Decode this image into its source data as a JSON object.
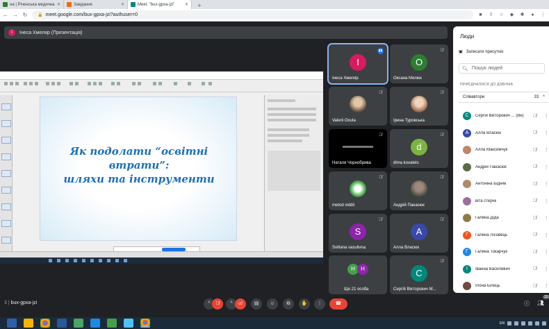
{
  "browser": {
    "tabs": [
      {
        "label": "на | Річенська медична",
        "color": "#2e7d32",
        "active": false
      },
      {
        "label": "Завдання",
        "color": "#ef6c00",
        "active": false
      },
      {
        "label": "Meet: \"bux-gpxa-jzi\"",
        "color": "#00897b",
        "active": true
      }
    ],
    "url": "meet.google.com/bux-gpxa-jzi?authuser=0"
  },
  "meet": {
    "presenter_initial": "I",
    "presenter_label": "Інеса Хмеляр (Презентація)",
    "meeting_code": "bux-gpxa-jzi",
    "badge": "33",
    "shared_slide": {
      "title_line1": "Як подолати “освітні втрати”:",
      "title_line2": "шляхи та інструменти"
    },
    "tiles": [
      {
        "initial": "І",
        "name": "Інеса Хмеляр",
        "color": "#d81b60",
        "speaking": true
      },
      {
        "initial": "О",
        "name": "Оксана Мелюк",
        "color": "#2e7d32"
      },
      {
        "initial": "",
        "name": "Valerii Oxuta",
        "color": "#8d6e63"
      },
      {
        "initial": "",
        "name": "Ірина Туровська",
        "color": "#bc8f6f"
      },
      {
        "initial": "",
        "name": "Наталя Чорнобрива",
        "color": "#000000"
      },
      {
        "initial": "d",
        "name": "dima kovalets",
        "color": "#7cb342"
      },
      {
        "initial": "",
        "name": "metod viddil",
        "color": "#4caf50"
      },
      {
        "initial": "",
        "name": "Андрій Панасюк",
        "color": "#5d6b4a"
      },
      {
        "initial": "S",
        "name": "Svitlana vasulivna",
        "color": "#8e24aa"
      },
      {
        "initial": "А",
        "name": "Алла Власюк",
        "color": "#3949ab"
      },
      {
        "initial": "",
        "name": "Ще 21 особа",
        "color": "#43a047"
      },
      {
        "initial": "С",
        "name": "Сергій Вікторович М...",
        "color": "#00897b"
      }
    ],
    "more_initials": [
      "Н",
      "Н"
    ]
  },
  "people": {
    "title": "Люди",
    "record_label": "Записати присутніх",
    "search_placeholder": "Пошук людей",
    "section_label": "ПРИЄДНАЛИСЯ ДО ДЗВІНКА",
    "group_label": "Співавтори",
    "group_count": "33",
    "list": [
      {
        "initial": "С",
        "name": "Сергій Вікторович ... (Ви)",
        "color": "#00897b"
      },
      {
        "initial": "А",
        "name": "Алла Власюк",
        "color": "#3949ab"
      },
      {
        "initial": "",
        "name": "Алла Максимчук",
        "color": "#c0846a"
      },
      {
        "initial": "",
        "name": "Андрій Панасюк",
        "color": "#5d6b4a"
      },
      {
        "initial": "",
        "name": "Антоніна Бідняк",
        "color": "#b08968"
      },
      {
        "initial": "",
        "name": "віта стерчк",
        "color": "#9c6f9c"
      },
      {
        "initial": "",
        "name": "Галина Діда",
        "color": "#8d7b4a"
      },
      {
        "initial": "Г",
        "name": "Галина Лісовець",
        "color": "#f4511e"
      },
      {
        "initial": "Г",
        "name": "Галина Токарчук",
        "color": "#1e88e5"
      },
      {
        "initial": "І",
        "name": "Іванна Василевич",
        "color": "#00897b"
      },
      {
        "initial": "",
        "name": "Ілона Білець",
        "color": "#6d4c41"
      }
    ]
  }
}
